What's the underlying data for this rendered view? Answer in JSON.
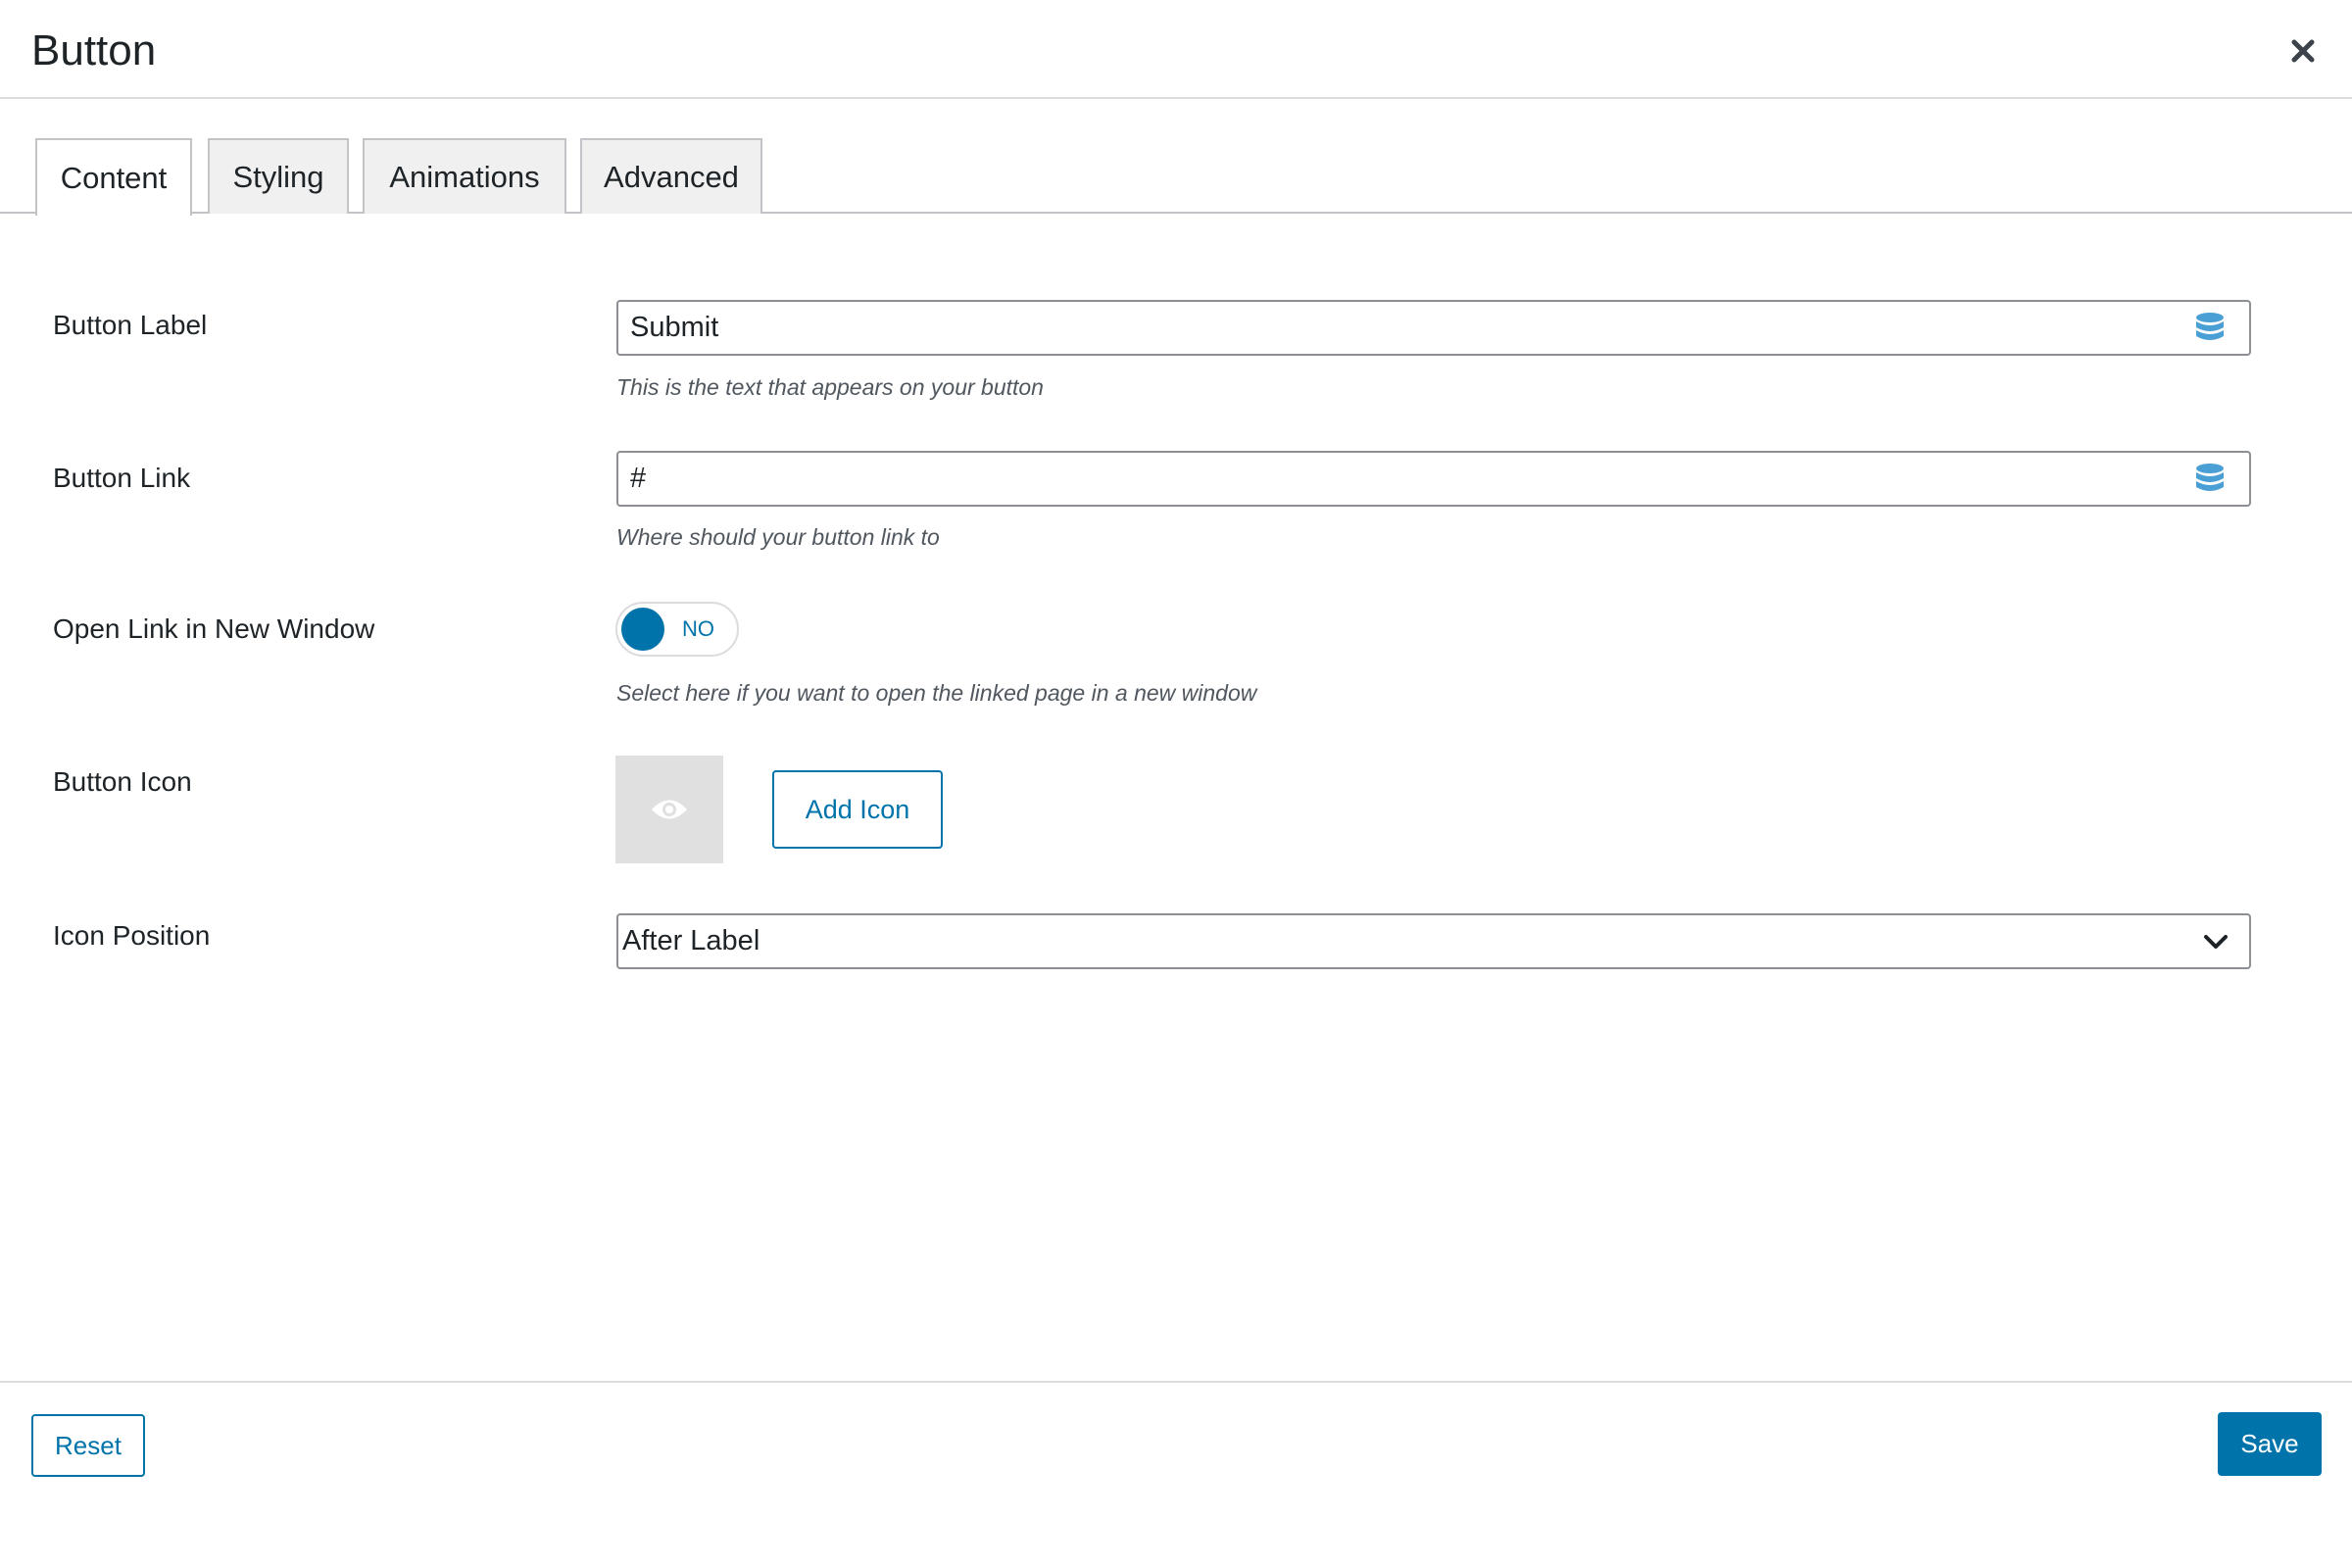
{
  "dialog": {
    "title": "Button",
    "close_icon": "close-icon"
  },
  "tabs": [
    {
      "label": "Content",
      "active": true
    },
    {
      "label": "Styling",
      "active": false
    },
    {
      "label": "Animations",
      "active": false
    },
    {
      "label": "Advanced",
      "active": false
    }
  ],
  "fields": {
    "button_label": {
      "label": "Button Label",
      "value": "Submit",
      "help": "This is the text that appears on your button",
      "icon": "database-icon"
    },
    "button_link": {
      "label": "Button Link",
      "value": "#",
      "help": "Where should your button link to",
      "icon": "database-icon"
    },
    "new_window": {
      "label": "Open Link in New Window",
      "state": "NO",
      "help": "Select here if you want to open the linked page in a new window"
    },
    "button_icon": {
      "label": "Button Icon",
      "preview_icon": "eye-icon",
      "add_label": "Add Icon"
    },
    "icon_position": {
      "label": "Icon Position",
      "value": "After Label",
      "icon": "chevron-down-icon"
    }
  },
  "footer": {
    "reset_label": "Reset",
    "save_label": "Save"
  },
  "colors": {
    "accent": "#0073aa",
    "border": "#8c8f94",
    "tab_bg": "#f0f0f1",
    "preview_bg": "#e0e0e0",
    "db_icon": "#4a9fd4"
  }
}
